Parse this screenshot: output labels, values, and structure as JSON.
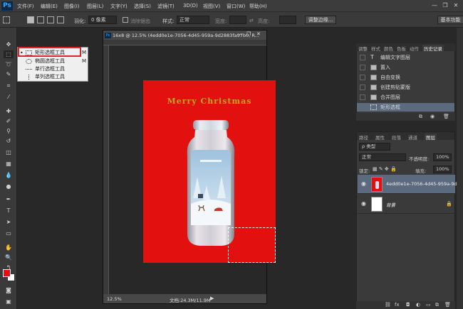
{
  "app": {
    "logo": "Ps"
  },
  "menu": [
    "文件(F)",
    "编辑(E)",
    "图像(I)",
    "图层(L)",
    "文字(Y)",
    "选择(S)",
    "滤镜(T)",
    "3D(D)",
    "视图(V)",
    "窗口(W)",
    "帮助(H)"
  ],
  "window_controls": {
    "minimize": "—",
    "restore": "❐",
    "close": "✕"
  },
  "options": {
    "feather_label": "羽化:",
    "feather_value": "0 像素",
    "antialias_label": "消除锯齿",
    "style_label": "样式:",
    "style_value": "正常",
    "width_label": "宽度:",
    "height_label": "高度:",
    "refine_edge": "调整边缘...",
    "workspace": "基本功能"
  },
  "flyout": [
    {
      "label": "矩形选框工具",
      "key": "M",
      "selected": true
    },
    {
      "label": "椭圆选框工具",
      "key": "M",
      "selected": false
    },
    {
      "label": "单行选框工具",
      "key": "",
      "selected": false
    },
    {
      "label": "单列选框工具",
      "key": "",
      "selected": false
    }
  ],
  "document": {
    "title": "16x8 @ 12.5% (4edd0e1e-7056-4d45-959a-9d2883fa97b0, R...",
    "zoom": "12.5%",
    "doc_size": "文档:24.3M/11.9M",
    "poster_text": "Merry Christmas",
    "poster_color": "#e31010"
  },
  "history": {
    "tabs": [
      "调整",
      "样式",
      "颜色",
      "色板",
      "动作",
      "历史记录"
    ],
    "active_tab": 5,
    "items": [
      {
        "label": "编辑文字图层"
      },
      {
        "label": "置入"
      },
      {
        "label": "自由变换"
      },
      {
        "label": "创建剪贴蒙版"
      },
      {
        "label": "合并图层"
      },
      {
        "label": "矩形选框"
      }
    ],
    "active_item": 5
  },
  "layers": {
    "tabs": [
      "路径",
      "属性",
      "段落",
      "通道",
      "图层"
    ],
    "active_tab": 4,
    "filter_value": "ρ 类型",
    "blend_mode": "正常",
    "opacity_label": "不透明度:",
    "opacity_value": "100%",
    "lock_label": "锁定:",
    "fill_label": "填充:",
    "fill_value": "100%",
    "items": [
      {
        "name": "4edd0e1e-7056-4d45-959a-9d2...",
        "visible": true
      },
      {
        "name": "背景",
        "visible": true,
        "locked": true
      }
    ]
  },
  "colors": {
    "foreground": "#e31010",
    "background": "#ffffff",
    "accent": "#e0232a"
  }
}
